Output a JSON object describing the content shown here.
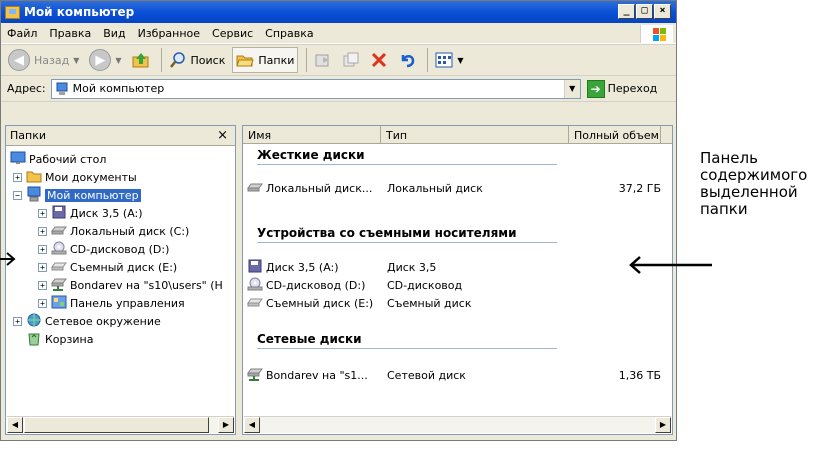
{
  "window": {
    "title": "Мой компьютер"
  },
  "menu": [
    "Файл",
    "Правка",
    "Вид",
    "Избранное",
    "Сервис",
    "Справка"
  ],
  "toolbar": {
    "back": "Назад",
    "search": "Поиск",
    "folders": "Папки"
  },
  "address": {
    "label": "Адрес:",
    "value": "Мой компьютер",
    "go": "Переход"
  },
  "folders_pane": {
    "title": "Папки",
    "close": "×"
  },
  "tree": [
    {
      "label": "Рабочий стол",
      "icon": "desktop-icon",
      "level": 0,
      "expander": ""
    },
    {
      "label": "Мои документы",
      "icon": "documents-icon",
      "level": 1,
      "expander": "+"
    },
    {
      "label": "Мой компьютер",
      "icon": "computer-icon",
      "level": 1,
      "expander": "−",
      "selected": true
    },
    {
      "label": "Диск 3,5 (A:)",
      "icon": "floppy-icon",
      "level": 2,
      "expander": "+"
    },
    {
      "label": "Локальный диск (C:)",
      "icon": "harddisk-icon",
      "level": 2,
      "expander": "+"
    },
    {
      "label": "CD-дисковод (D:)",
      "icon": "cd-icon",
      "level": 2,
      "expander": "+"
    },
    {
      "label": "Съемный диск (E:)",
      "icon": "removable-icon",
      "level": 2,
      "expander": "+"
    },
    {
      "label": "Bondarev на \"s10\\users\" (H",
      "icon": "network-drive-icon",
      "level": 2,
      "expander": "+"
    },
    {
      "label": "Панель управления",
      "icon": "control-panel-icon",
      "level": 2,
      "expander": "+"
    },
    {
      "label": "Сетевое окружение",
      "icon": "network-icon",
      "level": 1,
      "expander": "+"
    },
    {
      "label": "Корзина",
      "icon": "recycle-bin-icon",
      "level": 1,
      "expander": ""
    }
  ],
  "columns": {
    "name": "Имя",
    "type": "Тип",
    "total": "Полный объем"
  },
  "groups": [
    {
      "title": "Жесткие диски",
      "items": [
        {
          "name": "Локальный диск...",
          "type": "Локальный диск",
          "total": "37,2 ГБ",
          "icon": "harddisk-icon"
        }
      ]
    },
    {
      "title": "Устройства со съемными носителями",
      "items": [
        {
          "name": "Диск 3,5 (A:)",
          "type": "Диск 3,5",
          "total": "",
          "icon": "floppy-icon"
        },
        {
          "name": "CD-дисковод (D:)",
          "type": "CD-дисковод",
          "total": "",
          "icon": "cd-icon"
        },
        {
          "name": "Съемный диск (E:)",
          "type": "Съемный диск",
          "total": "",
          "icon": "removable-icon"
        }
      ]
    },
    {
      "title": "Сетевые диски",
      "items": [
        {
          "name": "Bondarev на \"s1...",
          "type": "Сетевой диск",
          "total": "1,36 ТБ",
          "icon": "network-drive-icon"
        }
      ]
    }
  ],
  "annotation": {
    "line1": "Панель",
    "line2": "содержимого",
    "line3": "выделенной",
    "line4": "папки"
  },
  "colors": {
    "titlebar": "#0a50d8",
    "selection": "#316ac5",
    "chrome": "#ece9d8"
  }
}
